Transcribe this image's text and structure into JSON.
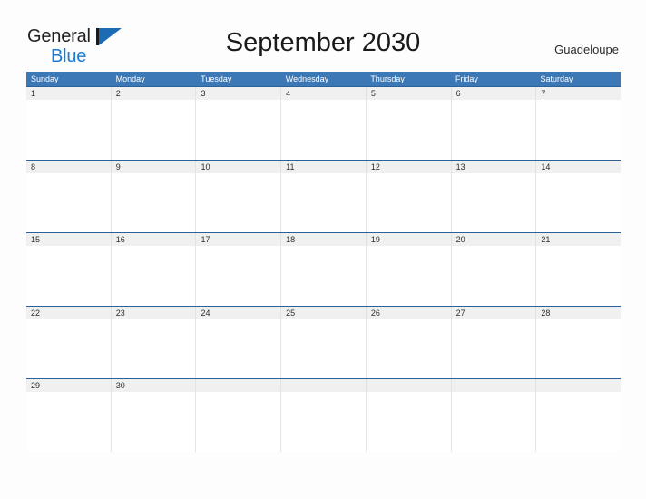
{
  "brand": {
    "word_one": "General",
    "word_two": "Blue",
    "flag_icon": "blue-flag-triangle-icon",
    "color_dark": "#231f20",
    "color_blue": "#1b7ad1"
  },
  "header": {
    "title": "September 2030",
    "region": "Guadeloupe"
  },
  "calendar": {
    "month": "September",
    "year": "2030",
    "accent_header_color": "#3c78b5",
    "row_separator_color": "#2a6199",
    "date_band_color": "#f0f0f0",
    "weekdays": [
      "Sunday",
      "Monday",
      "Tuesday",
      "Wednesday",
      "Thursday",
      "Friday",
      "Saturday"
    ],
    "weeks": [
      [
        "1",
        "2",
        "3",
        "4",
        "5",
        "6",
        "7"
      ],
      [
        "8",
        "9",
        "10",
        "11",
        "12",
        "13",
        "14"
      ],
      [
        "15",
        "16",
        "17",
        "18",
        "19",
        "20",
        "21"
      ],
      [
        "22",
        "23",
        "24",
        "25",
        "26",
        "27",
        "28"
      ],
      [
        "29",
        "30",
        "",
        "",
        "",
        "",
        ""
      ]
    ]
  }
}
